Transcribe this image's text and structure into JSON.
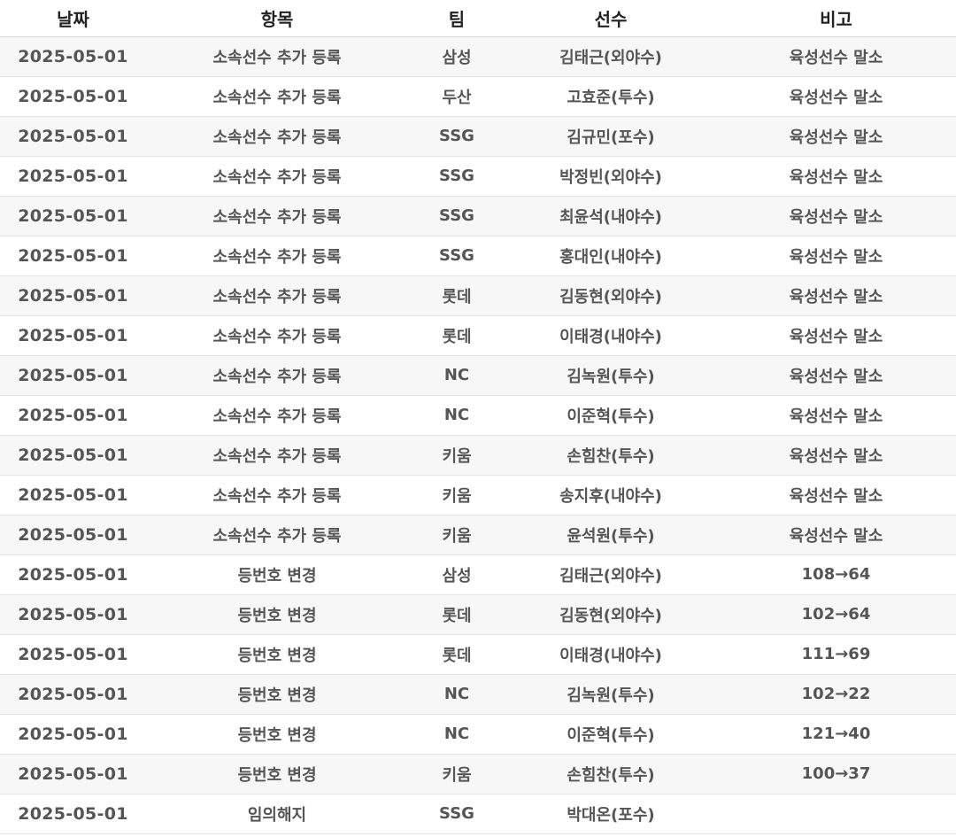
{
  "table": {
    "headers": [
      "날짜",
      "항목",
      "팀",
      "선수",
      "비고"
    ],
    "rows": [
      [
        "2025-05-01",
        "소속선수 추가 등록",
        "삼성",
        "김태근(외야수)",
        "육성선수 말소"
      ],
      [
        "2025-05-01",
        "소속선수 추가 등록",
        "두산",
        "고효준(투수)",
        "육성선수 말소"
      ],
      [
        "2025-05-01",
        "소속선수 추가 등록",
        "SSG",
        "김규민(포수)",
        "육성선수 말소"
      ],
      [
        "2025-05-01",
        "소속선수 추가 등록",
        "SSG",
        "박정빈(외야수)",
        "육성선수 말소"
      ],
      [
        "2025-05-01",
        "소속선수 추가 등록",
        "SSG",
        "최윤석(내야수)",
        "육성선수 말소"
      ],
      [
        "2025-05-01",
        "소속선수 추가 등록",
        "SSG",
        "홍대인(내야수)",
        "육성선수 말소"
      ],
      [
        "2025-05-01",
        "소속선수 추가 등록",
        "롯데",
        "김동현(외야수)",
        "육성선수 말소"
      ],
      [
        "2025-05-01",
        "소속선수 추가 등록",
        "롯데",
        "이태경(내야수)",
        "육성선수 말소"
      ],
      [
        "2025-05-01",
        "소속선수 추가 등록",
        "NC",
        "김녹원(투수)",
        "육성선수 말소"
      ],
      [
        "2025-05-01",
        "소속선수 추가 등록",
        "NC",
        "이준혁(투수)",
        "육성선수 말소"
      ],
      [
        "2025-05-01",
        "소속선수 추가 등록",
        "키움",
        "손힘찬(투수)",
        "육성선수 말소"
      ],
      [
        "2025-05-01",
        "소속선수 추가 등록",
        "키움",
        "송지후(내야수)",
        "육성선수 말소"
      ],
      [
        "2025-05-01",
        "소속선수 추가 등록",
        "키움",
        "윤석원(투수)",
        "육성선수 말소"
      ],
      [
        "2025-05-01",
        "등번호 변경",
        "삼성",
        "김태근(외야수)",
        "108→64"
      ],
      [
        "2025-05-01",
        "등번호 변경",
        "롯데",
        "김동현(외야수)",
        "102→64"
      ],
      [
        "2025-05-01",
        "등번호 변경",
        "롯데",
        "이태경(내야수)",
        "111→69"
      ],
      [
        "2025-05-01",
        "등번호 변경",
        "NC",
        "김녹원(투수)",
        "102→22"
      ],
      [
        "2025-05-01",
        "등번호 변경",
        "NC",
        "이준혁(투수)",
        "121→40"
      ],
      [
        "2025-05-01",
        "등번호 변경",
        "키움",
        "손힘찬(투수)",
        "100→37"
      ],
      [
        "2025-05-01",
        "임의해지",
        "SSG",
        "박대온(포수)",
        ""
      ]
    ]
  }
}
